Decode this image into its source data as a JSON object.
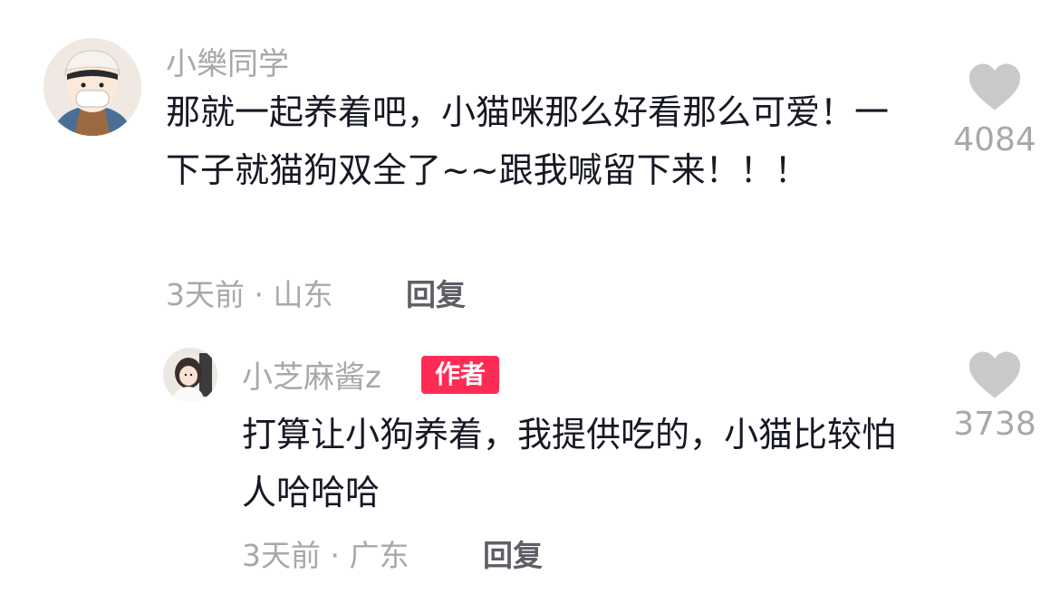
{
  "comments": [
    {
      "username": "小樂同学",
      "text": "那就一起养着吧，小猫咪那么好看那么可爱！一下子就猫狗双全了~~跟我喊留下来！！！",
      "meta": "3天前 · 山东",
      "reply_label": "回复",
      "like_count": "4084"
    },
    {
      "username": "小芝麻酱z",
      "badge": "作者",
      "text": "打算让小狗养着，我提供吃的，小猫比较怕人哈哈哈",
      "meta": "3天前 · 广东",
      "reply_label": "回复",
      "like_count": "3738"
    }
  ],
  "icons": {
    "like": "heart-icon"
  },
  "colors": {
    "badge": "#fe2c55",
    "secondary_text": "#a8a8ac",
    "primary_text": "#161823",
    "heart": "#c9c9cc"
  }
}
